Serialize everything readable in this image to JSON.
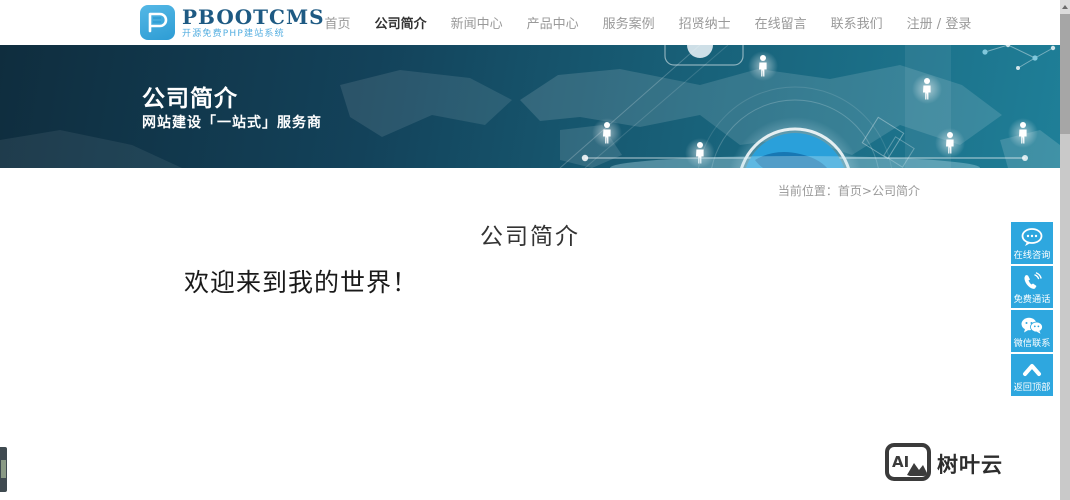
{
  "header": {
    "logo": {
      "name": "PBOOTCMS",
      "tagline": "开源免费PHP建站系统"
    },
    "nav": [
      {
        "label": "首页"
      },
      {
        "label": "公司简介"
      },
      {
        "label": "新闻中心"
      },
      {
        "label": "产品中心"
      },
      {
        "label": "服务案例"
      },
      {
        "label": "招贤纳士"
      },
      {
        "label": "在线留言"
      },
      {
        "label": "联系我们"
      },
      {
        "label": "注册 / 登录"
      }
    ]
  },
  "banner": {
    "title": "公司简介",
    "subtitle": "网站建设「一站式」服务商"
  },
  "breadcrumb": {
    "prefix": "当前位置：",
    "home": "首页",
    "separator": ">",
    "current": "公司简介"
  },
  "main": {
    "heading": "公司简介",
    "content": "欢迎来到我的世界！"
  },
  "floating_toolbar": [
    {
      "label": "在线咨询",
      "icon": "chat-icon"
    },
    {
      "label": "免费通话",
      "icon": "phone-icon"
    },
    {
      "label": "微信联系",
      "icon": "wechat-icon"
    },
    {
      "label": "返回顶部",
      "icon": "arrow-up-icon"
    }
  ],
  "watermark": {
    "icon_text": "AI",
    "label": "树叶云"
  },
  "colors": {
    "accent_blue": "#2ea7df",
    "logo_blue": "#3aa5d9",
    "banner_dark": "#0f2d3e",
    "banner_teal": "#1f7f98",
    "nav_text": "#999999",
    "nav_active": "#333333",
    "heading_text": "#333333"
  }
}
